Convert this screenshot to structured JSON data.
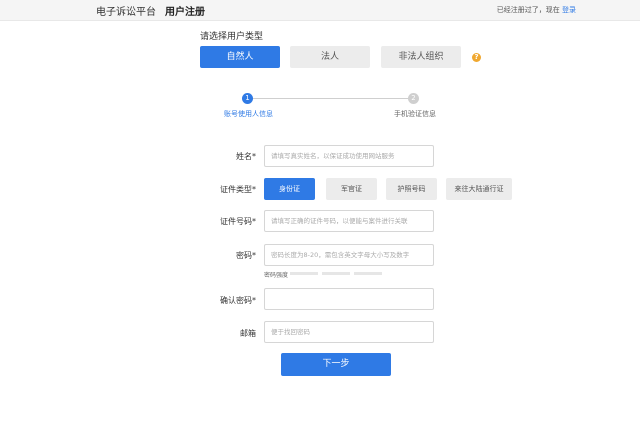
{
  "header": {
    "brand": "电子诉讼平台",
    "page_title": "用户注册",
    "login_hint": "已经注册过了，现在",
    "login_link": "登录"
  },
  "user_type": {
    "label": "请选择用户类型",
    "options": [
      "自然人",
      "法人",
      "非法人组织"
    ],
    "selected": "自然人",
    "help_icon": "question-icon"
  },
  "steps": [
    {
      "number": "1",
      "label": "账号使用人信息",
      "active": true
    },
    {
      "number": "2",
      "label": "手机验证信息",
      "active": false
    }
  ],
  "form": {
    "name": {
      "label": "姓名*",
      "placeholder": "请填写真实姓名，以保证成功使用网站服务"
    },
    "id_type": {
      "label": "证件类型*",
      "options": [
        "身份证",
        "军官证",
        "护照号码",
        "来往大陆通行证"
      ],
      "selected": "身份证"
    },
    "id_number": {
      "label": "证件号码*",
      "placeholder": "请填写正确的证件号码，以便能与案件进行关联"
    },
    "password": {
      "label": "密码*",
      "placeholder": "密码长度为8-20，需包含英文字母大小写及数字",
      "strength_label": "密码强度"
    },
    "confirm_password": {
      "label": "确认密码*",
      "placeholder": ""
    },
    "email": {
      "label": "邮箱",
      "placeholder": "便于找回密码"
    }
  },
  "next_button": "下一步",
  "colors": {
    "accent": "#2f7ae5",
    "inactive": "#ececec",
    "help": "#f0a830"
  }
}
